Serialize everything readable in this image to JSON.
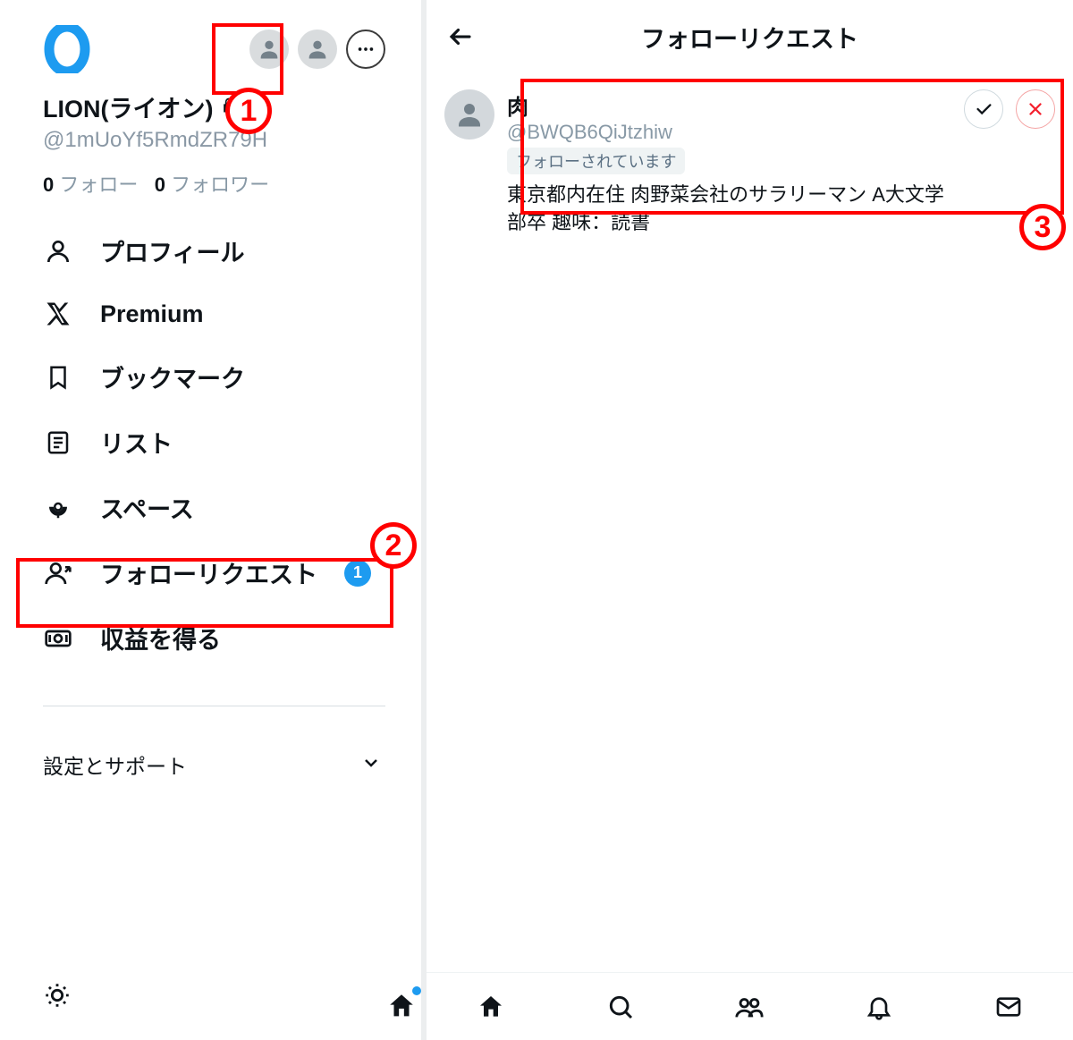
{
  "left": {
    "user_name": "LION(ライオン)",
    "user_handle": "@1mUoYf5RmdZR79H",
    "following_count": "0",
    "following_label": "フォロー",
    "follower_count": "0",
    "follower_label": "フォロワー",
    "nav": {
      "profile": "プロフィール",
      "premium": "Premium",
      "bookmarks": "ブックマーク",
      "lists": "リスト",
      "spaces": "スペース",
      "follow_requests": "フォローリクエスト",
      "follow_requests_badge": "1",
      "monetize": "収益を得る"
    },
    "settings_support": "設定とサポート"
  },
  "right": {
    "title": "フォローリクエスト",
    "request": {
      "name": "肉",
      "handle": "@BWQB6QiJtzhiw",
      "followed_tag": "フォローされています",
      "bio": "東京都内在住 肉野菜会社のサラリーマン A大文学部卒 趣味：読書"
    }
  },
  "annotations": {
    "n1": "1",
    "n2": "2",
    "n3": "3"
  }
}
